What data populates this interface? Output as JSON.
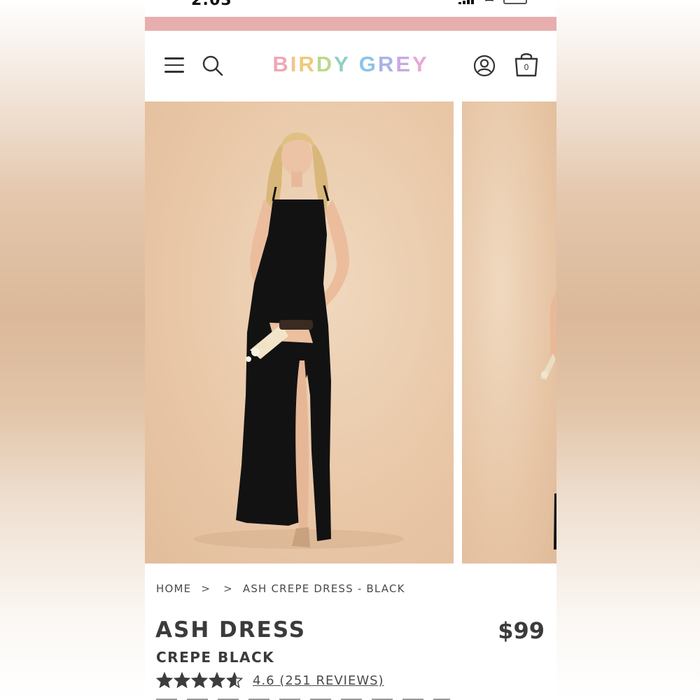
{
  "status_bar": {
    "time": "2:03"
  },
  "colors": {
    "promo_bar": "#e8aeae",
    "text_dark": "#3b3b3b",
    "star": "#3d3d3d",
    "dress": "#121212"
  },
  "header": {
    "logo_text": "BIRDY GREY",
    "logo_letter_colors": [
      "#f0a7b4",
      "#f5c48a",
      "#f0c979",
      "#b9d98c",
      "#8fd0c4",
      "#ffffff",
      "#8cc3e8",
      "#a9b4e6",
      "#c8a9e4",
      "#e6a9d8"
    ],
    "icons": [
      "menu-icon",
      "search-icon",
      "account-icon",
      "cart-icon"
    ],
    "cart_count": "0"
  },
  "gallery": {
    "images": [
      "product-photo-front",
      "product-photo-side"
    ]
  },
  "breadcrumb": {
    "home": "HOME",
    "separator": ">",
    "current": "ASH CREPE DRESS - BLACK"
  },
  "product": {
    "name": "ASH DRESS",
    "price": "$99",
    "color": "CREPE BLACK",
    "rating": 4.6,
    "rating_text": "4.6 (251 REVIEWS)"
  }
}
